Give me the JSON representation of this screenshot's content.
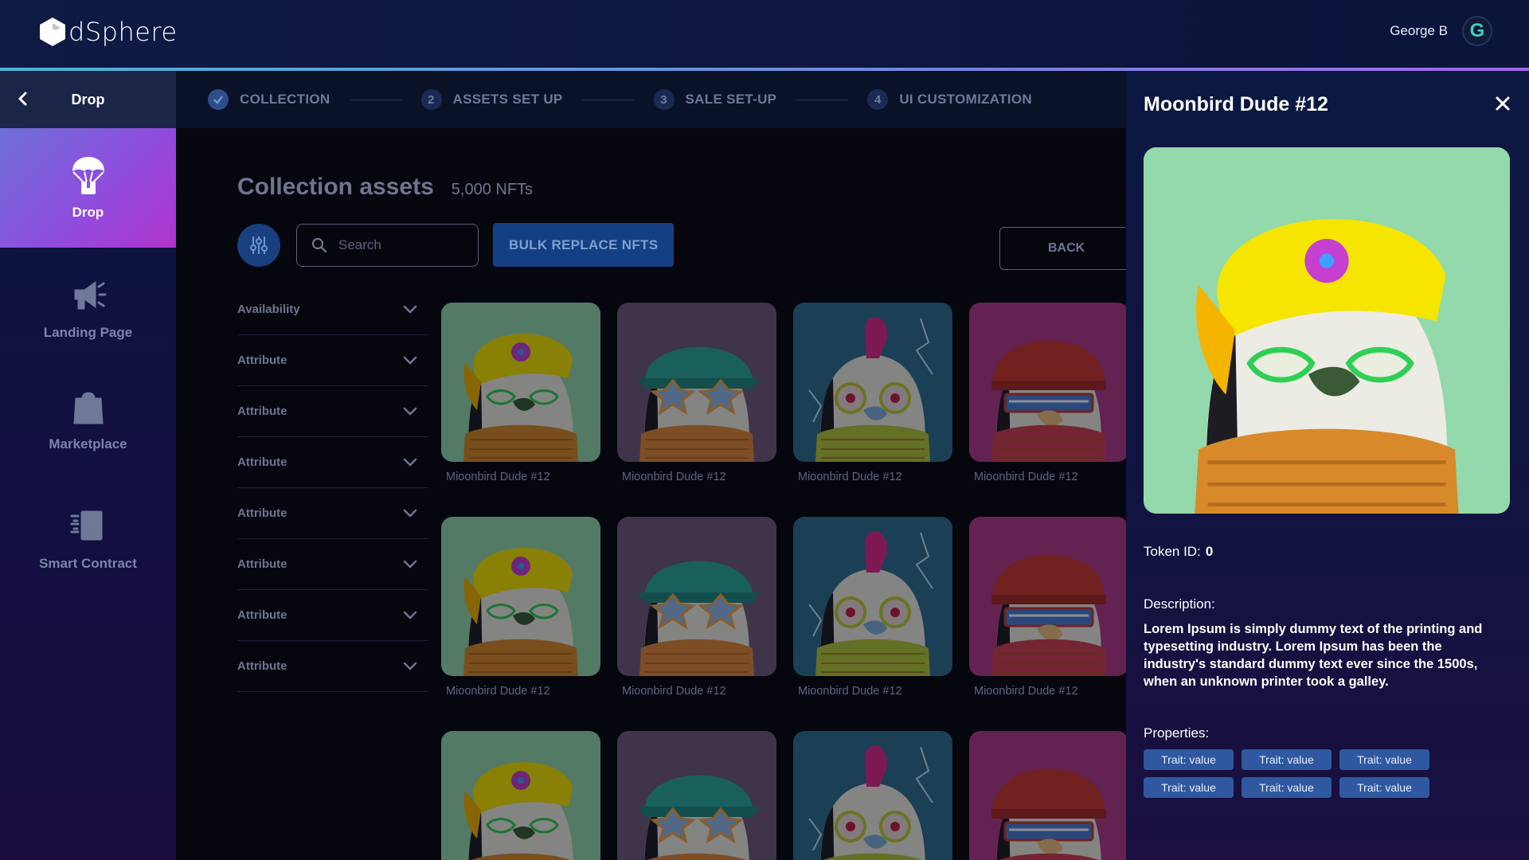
{
  "app": {
    "name": "dSphere",
    "user": "George B",
    "avatar_letter": "G"
  },
  "sidebar": {
    "header": "Drop",
    "items": [
      {
        "label": "Drop",
        "icon": "parachute-icon",
        "active": true
      },
      {
        "label": "Landing Page",
        "icon": "megaphone-icon",
        "active": false
      },
      {
        "label": "Marketplace",
        "icon": "nft-bag-icon",
        "active": false
      },
      {
        "label": "Smart Contract",
        "icon": "contract-icon",
        "active": false
      }
    ]
  },
  "stepper": {
    "steps": [
      {
        "num": "",
        "label": "COLLECTION",
        "done": true
      },
      {
        "num": "2",
        "label": "ASSETS SET UP"
      },
      {
        "num": "3",
        "label": "SALE SET-UP"
      },
      {
        "num": "4",
        "label": "UI CUSTOMIZATION"
      }
    ]
  },
  "collection": {
    "title": "Collection assets",
    "count": "5,000 NFTs",
    "search_placeholder": "Search",
    "bulk_label": "BULK REPLACE NFTS",
    "back_label": "BACK"
  },
  "filters": [
    "Availability",
    "Attribute",
    "Attribute",
    "Attribute",
    "Attribute",
    "Attribute",
    "Attribute",
    "Attribute"
  ],
  "cards": [
    {
      "name": "Mioonbird Dude #12",
      "variant": "yellow-hat"
    },
    {
      "name": "Mioonbird Dude #12",
      "variant": "teal-hat"
    },
    {
      "name": "Mioonbird Dude #12",
      "variant": "mohawk"
    },
    {
      "name": "Mioonbird Dude #12",
      "variant": "red-beanie"
    },
    {
      "name": "Mioonbird Dude #12",
      "variant": "yellow-hat"
    },
    {
      "name": "Mioonbird Dude #12",
      "variant": "teal-hat"
    },
    {
      "name": "Mioonbird Dude #12",
      "variant": "mohawk"
    },
    {
      "name": "Mioonbird Dude #12",
      "variant": "red-beanie"
    },
    {
      "name": "",
      "variant": "yellow-hat"
    },
    {
      "name": "",
      "variant": "teal-hat"
    },
    {
      "name": "",
      "variant": "mohawk"
    },
    {
      "name": "",
      "variant": "red-beanie"
    }
  ],
  "detail": {
    "title": "Moonbird Dude #12",
    "token_label": "Token ID:",
    "token_value": "0",
    "description_label": "Description:",
    "description": "Lorem Ipsum is simply dummy text of the printing and typesetting industry. Lorem Ipsum has been the industry's standard dummy text ever since the 1500s, when an unknown printer took a galley.",
    "properties_label": "Properties:",
    "properties": [
      "Trait: value",
      "Trait: value",
      "Trait: value",
      "Trait: value",
      "Trait: value",
      "Trait: value"
    ]
  },
  "colors": {
    "accent": "#2f58a0",
    "active_gradient_start": "#6f6fd8",
    "active_gradient_end": "#b133cc",
    "header_line_start": "#4db4d8",
    "header_line_end": "#a066e6"
  }
}
